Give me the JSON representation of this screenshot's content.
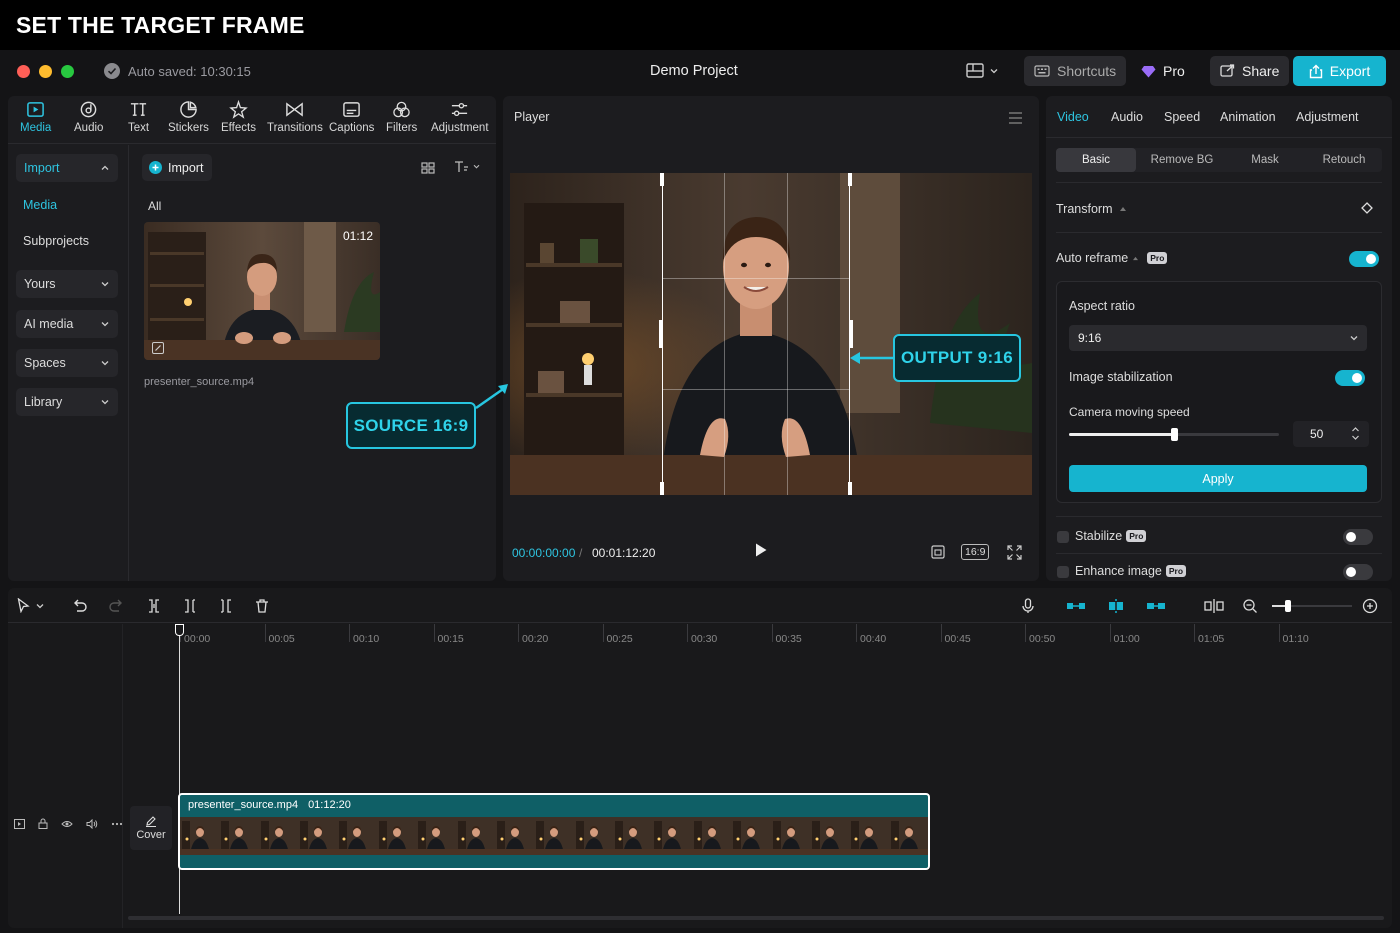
{
  "headline": "SET THE TARGET FRAME",
  "topbar": {
    "autosave": "Auto saved: 10:30:15",
    "project_title": "Demo Project",
    "shortcuts_label": "Shortcuts",
    "pro_label": "Pro",
    "share_label": "Share",
    "export_label": "Export"
  },
  "toolbar": {
    "tools": [
      "Media",
      "Audio",
      "Text",
      "Stickers",
      "Effects",
      "Transitions",
      "Captions",
      "Filters",
      "Adjustment"
    ],
    "active": "Media"
  },
  "sidebar": {
    "import_label": "Import",
    "media_label": "Media",
    "subprojects_label": "Subprojects",
    "groups": [
      "Yours",
      "AI media",
      "Spaces",
      "Library"
    ]
  },
  "media_panel": {
    "import_button": "Import",
    "filter_all": "All",
    "clip": {
      "duration": "01:12",
      "filename": "presenter_source.mp4"
    }
  },
  "callouts": {
    "source": "SOURCE 16:9",
    "output": "OUTPUT 9:16"
  },
  "player": {
    "title": "Player",
    "current_time": "00:00:00:00",
    "total_time": "00:01:12:20",
    "ratio_badge": "16:9"
  },
  "inspector": {
    "tabs": [
      "Video",
      "Audio",
      "Speed",
      "Animation",
      "Adjustment"
    ],
    "active_tab": "Video",
    "subtabs": [
      "Basic",
      "Remove BG",
      "Mask",
      "Retouch"
    ],
    "active_subtab": "Basic",
    "transform_label": "Transform",
    "auto_reframe_label": "Auto reframe",
    "auto_reframe_on": true,
    "aspect_ratio_label": "Aspect ratio",
    "aspect_ratio_value": "9:16",
    "image_stabilization_label": "Image stabilization",
    "image_stabilization_on": true,
    "camera_speed_label": "Camera moving speed",
    "camera_speed_value": "50",
    "camera_speed_fraction": 0.5,
    "apply_label": "Apply",
    "stabilize_label": "Stabilize",
    "stabilize_on": false,
    "enhance_label": "Enhance image",
    "enhance_on": false,
    "pro_badge": "Pro"
  },
  "timeline": {
    "ruler": [
      "00:00",
      "00:05",
      "00:10",
      "00:15",
      "00:20",
      "00:25",
      "00:30",
      "00:35",
      "00:40",
      "00:45",
      "00:50",
      "01:00",
      "01:05",
      "01:10"
    ],
    "cover_label": "Cover",
    "clip_name": "presenter_source.mp4",
    "clip_duration": "01:12:20",
    "zoom_fraction": 0.2
  },
  "colors": {
    "accent": "#16b4cf",
    "callout": "#27c6e0",
    "background": "#141416",
    "panel": "#1c1c1f"
  }
}
